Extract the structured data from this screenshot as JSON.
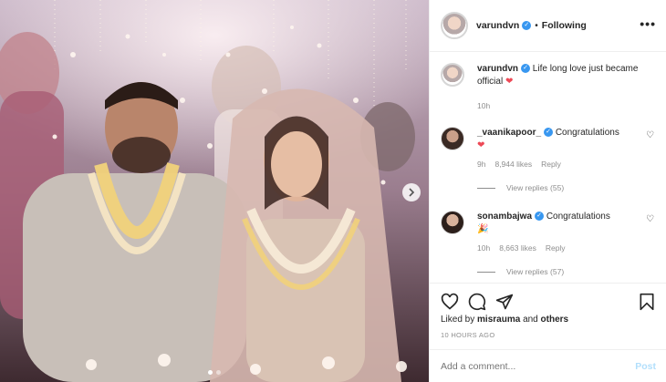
{
  "post": {
    "username": "varundvn",
    "follow_state": "Following",
    "separator": "•",
    "more_icon": "•••"
  },
  "caption": {
    "username": "varundvn",
    "text": "Life long love just became official",
    "emoji": "❤",
    "age": "10h"
  },
  "comments": [
    {
      "username": "_vaanikapoor_",
      "text": "Congratulations",
      "emoji": "❤",
      "age": "9h",
      "likes": "8,944 likes",
      "reply": "Reply",
      "view_replies": "View replies (55)"
    },
    {
      "username": "sonambajwa",
      "text": "Congratulations",
      "emoji": "🎉",
      "age": "10h",
      "likes": "8,663 likes",
      "reply": "Reply",
      "view_replies": "View replies (57)"
    }
  ],
  "engagement": {
    "liked_by_prefix": "Liked by",
    "liked_by_user": "misrauma",
    "liked_by_conj": "and",
    "liked_by_others": "others",
    "timestamp": "10 HOURS AGO"
  },
  "composer": {
    "placeholder": "Add a comment...",
    "post_label": "Post"
  },
  "carousel": {
    "current_index": 1,
    "total": 2
  },
  "icons": {
    "heart": "heart-icon",
    "comment": "comment-icon",
    "share": "share-icon",
    "save": "bookmark-icon",
    "next": "chevron-right-icon"
  }
}
